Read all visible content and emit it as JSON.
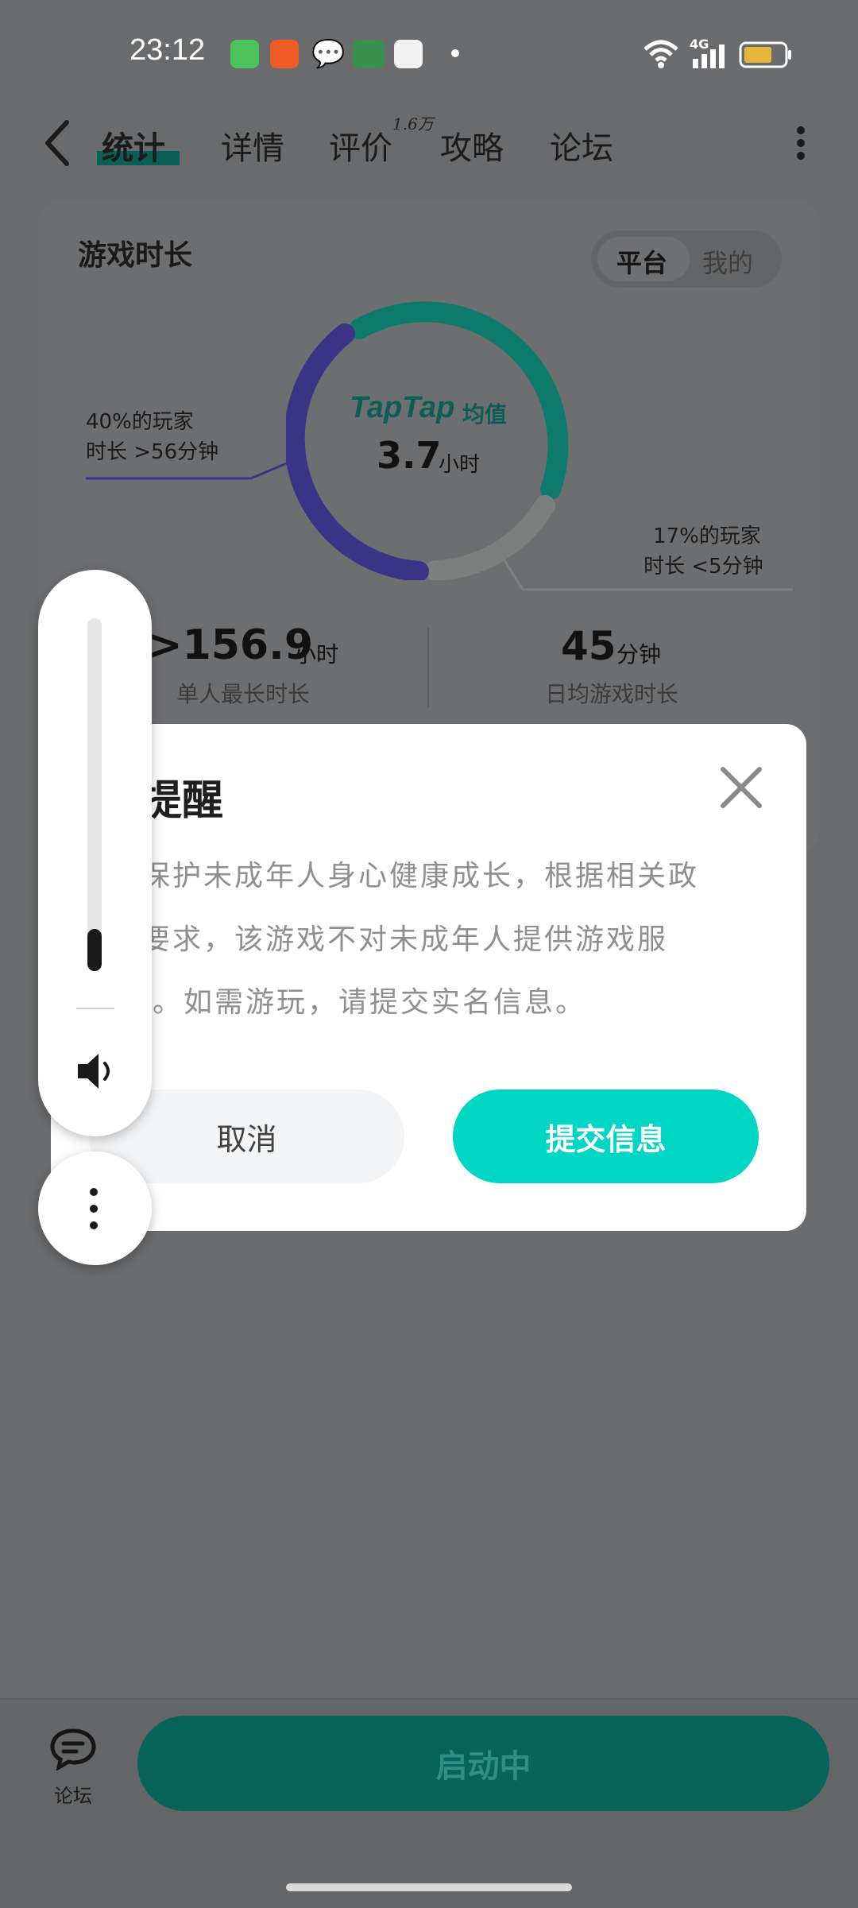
{
  "status_bar": {
    "time": "23:12",
    "network": "4G"
  },
  "nav": {
    "tabs": [
      {
        "label": "统计",
        "active": true
      },
      {
        "label": "详情"
      },
      {
        "label": "评价",
        "badge": "1.6万"
      },
      {
        "label": "攻略"
      },
      {
        "label": "论坛"
      }
    ]
  },
  "stats": {
    "title": "游戏时长",
    "toggle": {
      "platform": "平台",
      "mine": "我的"
    },
    "center_brand": "TapTap",
    "center_label": "均值",
    "center_value": "3.7",
    "center_unit": "小时",
    "left_callout": {
      "line1": "40%的玩家",
      "line2": "时长 >56分钟"
    },
    "right_callout": {
      "line1": "17%的玩家",
      "line2": "时长 <5分钟"
    },
    "max_value": ">156.9",
    "max_unit": "小时",
    "max_label": "单人最长时长",
    "daily_value": "45",
    "daily_unit": "分钟",
    "daily_label": "日均游戏时长"
  },
  "dialog": {
    "title": "名提醒",
    "line1": "保护未成年人身心健康成长，根据相关政",
    "line2": "要求，该游戏不对未成年人提供游戏服",
    "line3": "。如需游玩，请提交实名信息。",
    "cancel": "取消",
    "submit": "提交信息"
  },
  "volume": {
    "level": 0.12
  },
  "bottom": {
    "forum_label": "论坛",
    "launch": "启动中"
  },
  "colors": {
    "accent_teal": "#00d6c4",
    "ring_teal": "#0e7a6c",
    "ring_purple": "#3b3385",
    "launch_green": "#066459"
  }
}
